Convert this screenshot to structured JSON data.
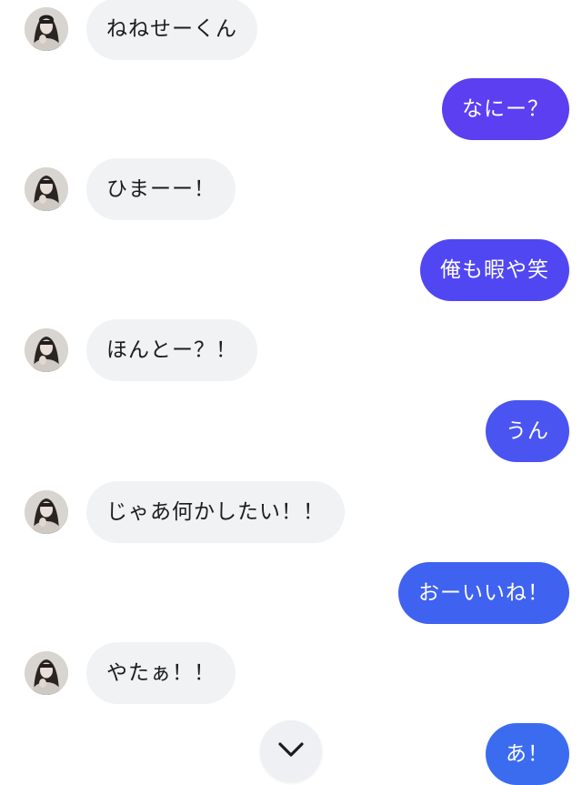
{
  "messages": [
    {
      "side": "in",
      "text": "ねねせーくん"
    },
    {
      "side": "out",
      "text": "なにー？",
      "color": "#5b3ff0"
    },
    {
      "side": "in",
      "text": "ひまーー！"
    },
    {
      "side": "out",
      "text": "俺も暇や笑",
      "color": "#5147f2"
    },
    {
      "side": "in",
      "text": "ほんとー？！"
    },
    {
      "side": "out",
      "text": "うん",
      "color": "#4a54f1"
    },
    {
      "side": "in",
      "text": "じゃあ何かしたい！！"
    },
    {
      "side": "out",
      "text": "おーいいね！",
      "color": "#3f62f0"
    },
    {
      "side": "in",
      "text": "やたぁ！！"
    },
    {
      "side": "out",
      "text": "あ！",
      "color": "#3b6cf0"
    }
  ],
  "scroll_button": {
    "icon": "chevron-down-icon"
  },
  "colors": {
    "incoming_bubble": "#f1f2f4",
    "incoming_text": "#1c1c1e",
    "outgoing_text": "#ffffff"
  }
}
